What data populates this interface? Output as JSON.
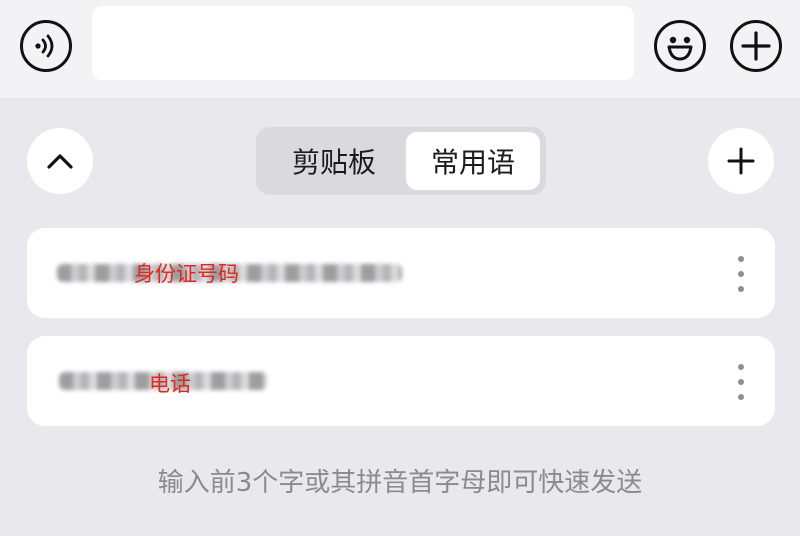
{
  "input_bar": {
    "text_value": "",
    "voice_icon": "voice-input-icon",
    "emoji_icon": "emoji-icon",
    "add_icon": "plus-icon"
  },
  "toolbar": {
    "collapse_icon": "chevron-up-icon",
    "add_icon": "plus-icon"
  },
  "tabs": [
    {
      "label": "剪贴板",
      "selected": false
    },
    {
      "label": "常用语",
      "selected": true
    }
  ],
  "phrases": [
    {
      "label": "身份证号码"
    },
    {
      "label": "电话"
    }
  ],
  "hint": "输入前3个字或其拼音首字母即可快速发送",
  "colors": {
    "background": "#e9e9ed",
    "card": "#ffffff",
    "label_red": "#e0281e",
    "hint_gray": "#8a8a8f"
  }
}
